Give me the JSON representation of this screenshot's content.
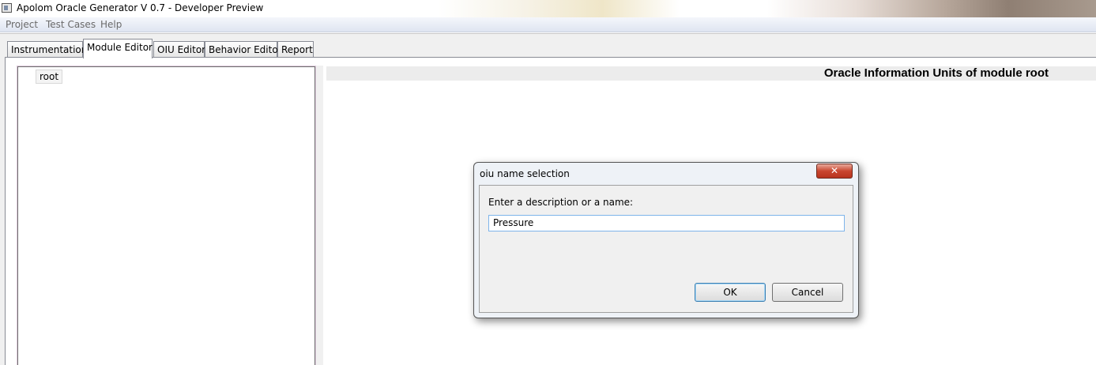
{
  "window": {
    "title": "Apolom Oracle Generator V 0.7 - Developer Preview",
    "icon": "app-window-icon"
  },
  "menu": [
    "Project",
    "Test Cases",
    "Help"
  ],
  "tabs": [
    {
      "label": "Instrumentation",
      "active": false
    },
    {
      "label": "Module Editor",
      "active": true
    },
    {
      "label": "OIU Editor",
      "active": false
    },
    {
      "label": "Behavior Editor",
      "active": false
    },
    {
      "label": "Report",
      "active": false
    }
  ],
  "tree": {
    "nodes": [
      {
        "label": "root"
      }
    ]
  },
  "oiu_panel": {
    "title": "Oracle Information Units of module root"
  },
  "dialog": {
    "title": "oiu name selection",
    "close_icon": "close-icon",
    "close_glyph": "✕",
    "prompt": "Enter a description or a name:",
    "input_value": "Pressure",
    "ok_label": "OK",
    "cancel_label": "Cancel"
  },
  "colors": {
    "close_button": "#c9462f",
    "input_focus_border": "#7eb4ea",
    "tree_border": "#dbc7d9"
  }
}
